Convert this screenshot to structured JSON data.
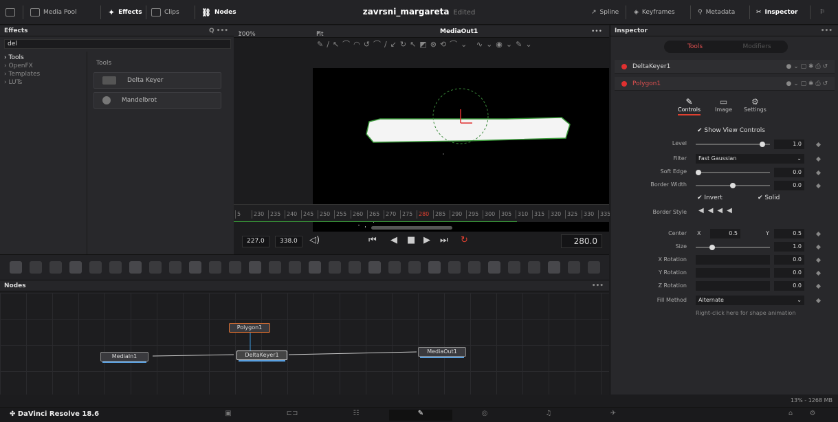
{
  "topbar": {
    "media_pool": "Media Pool",
    "effects": "Effects",
    "clips": "Clips",
    "nodes": "Nodes",
    "project_title": "zavrsni_margareta",
    "edited": "Edited",
    "spline": "Spline",
    "keyframes": "Keyframes",
    "metadata": "Metadata",
    "inspector": "Inspector"
  },
  "effects": {
    "title": "Effects",
    "search_value": "del",
    "tree": [
      "Tools",
      "OpenFX",
      "Templates",
      "LUTs"
    ],
    "section": "Tools",
    "items": [
      "Delta Keyer",
      "Mandelbrot"
    ]
  },
  "viewer": {
    "zoom": "100%",
    "fit": "Fit",
    "output": "MediaOut1",
    "ticks": [
      "5",
      "230",
      "235",
      "240",
      "245",
      "250",
      "255",
      "260",
      "265",
      "270",
      "275",
      "280",
      "285",
      "290",
      "295",
      "300",
      "305",
      "310",
      "315",
      "320",
      "325",
      "330",
      "335"
    ],
    "in": "227.0",
    "out": "338.0",
    "frame": "280.0"
  },
  "nodes": {
    "title": "Nodes",
    "n1": "MediaIn1",
    "n2": "Polygon1",
    "n3": "DeltaKeyer1",
    "n4": "MediaOut1"
  },
  "inspector": {
    "title": "Inspector",
    "tab_tools": "Tools",
    "tab_modifiers": "Modifiers",
    "tool1": "DeltaKeyer1",
    "tool2": "Polygon1",
    "subtabs": [
      "Controls",
      "Image",
      "Settings"
    ],
    "show_view_controls": "Show View Controls",
    "level_label": "Level",
    "level": "1.0",
    "level_frac": 0.93,
    "filter_label": "Filter",
    "filter": "Fast Gaussian",
    "soft_edge_label": "Soft Edge",
    "soft_edge": "0.0",
    "border_width_label": "Border Width",
    "border_width": "0.0",
    "invert": "Invert",
    "solid": "Solid",
    "border_style_label": "Border Style",
    "center_label": "Center",
    "x_label": "X",
    "center_x": "0.5",
    "y_label": "Y",
    "center_y": "0.5",
    "size_label": "Size",
    "size": "1.0",
    "xrot_label": "X Rotation",
    "xrot": "0.0",
    "yrot_label": "Y Rotation",
    "yrot": "0.0",
    "zrot_label": "Z Rotation",
    "zrot": "0.0",
    "fill_label": "Fill Method",
    "fill": "Alternate",
    "hint": "Right-click here for shape animation"
  },
  "status": {
    "memory": "13% - 1268 MB"
  },
  "bottom": {
    "app": "DaVinci Resolve 18.6"
  }
}
